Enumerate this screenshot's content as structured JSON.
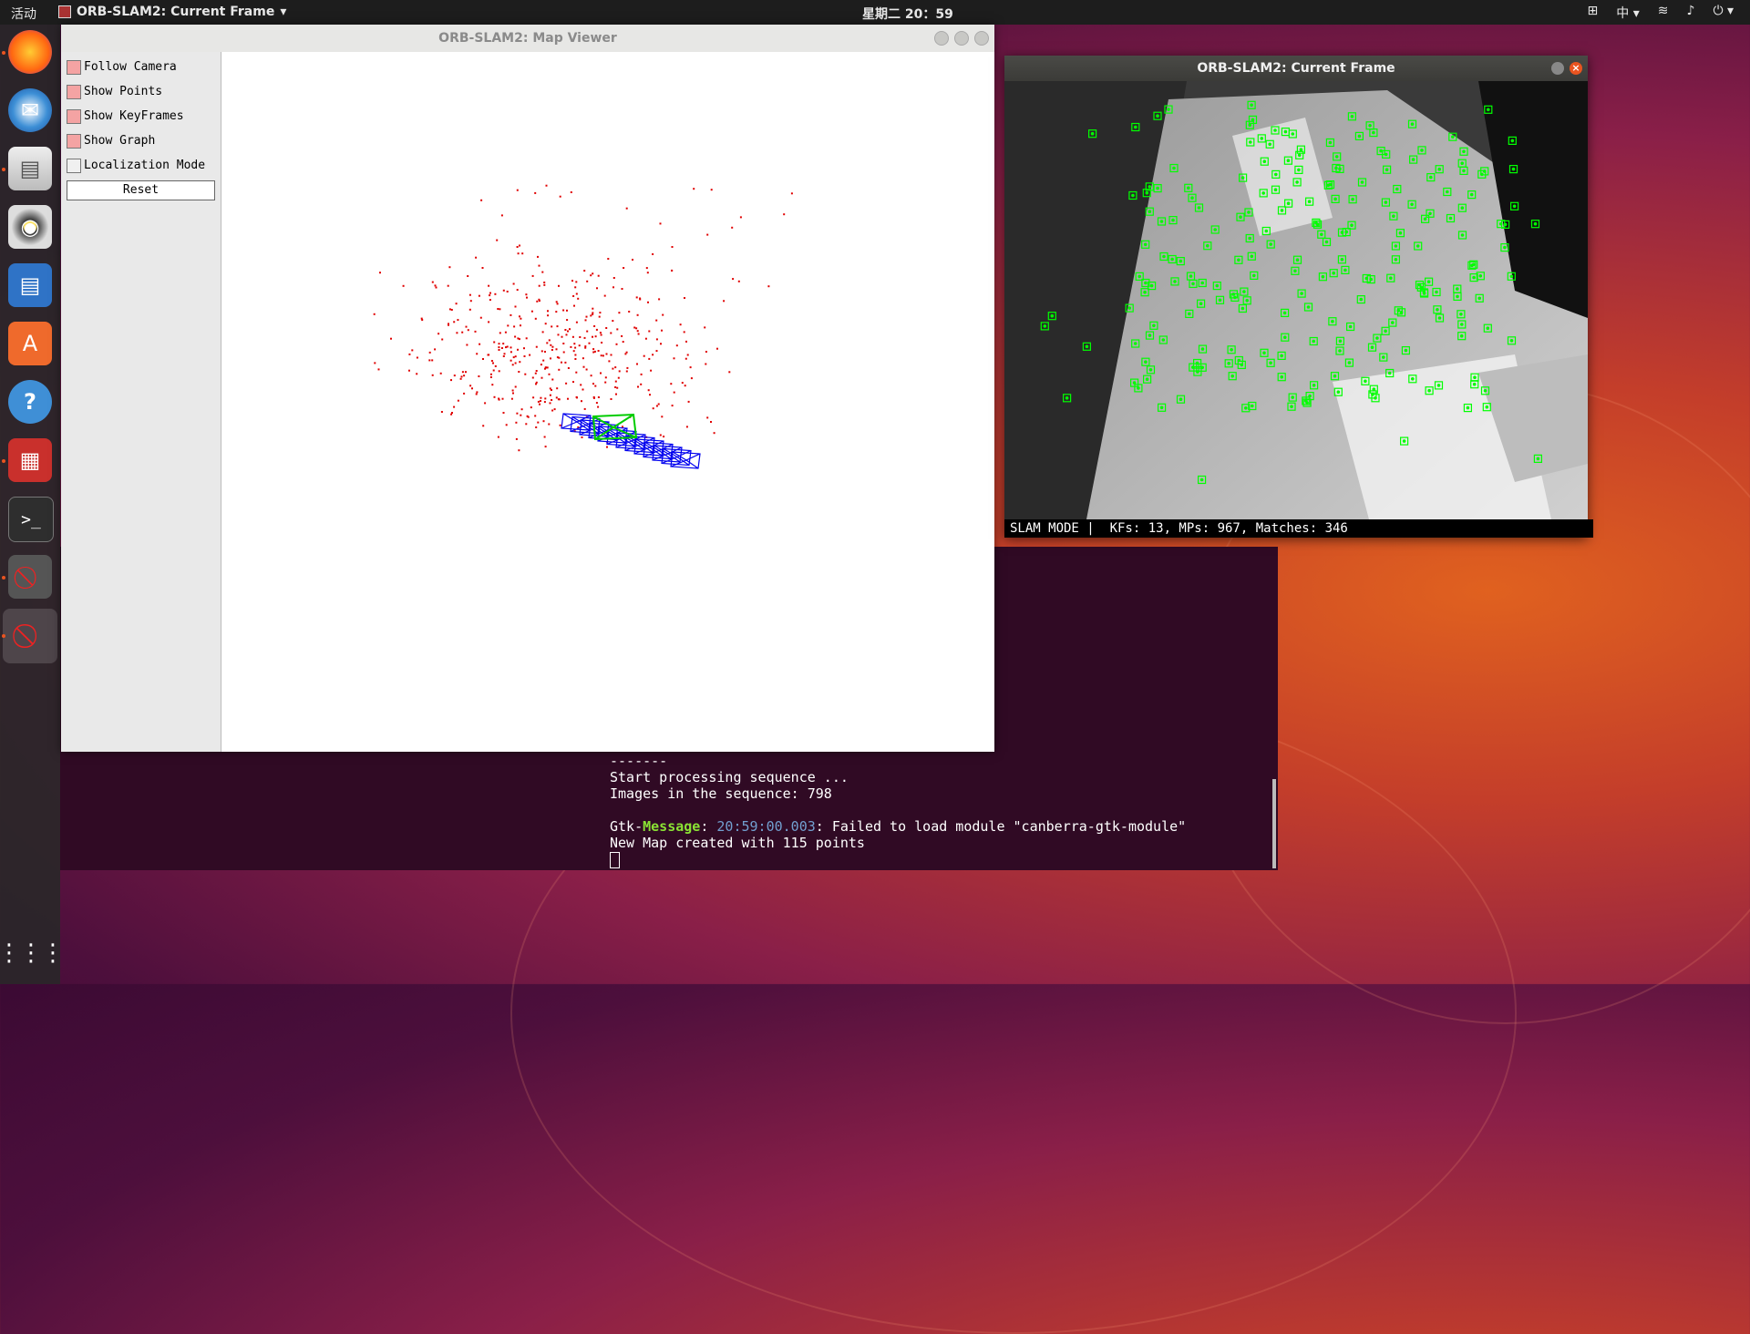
{
  "topbar": {
    "activities": "活动",
    "app_menu_label": "ORB-SLAM2: Current Frame",
    "clock": "星期二 20：59",
    "input_method": "中",
    "icons": [
      "network-icon",
      "input-method-icon",
      "wifi-icon",
      "volume-icon",
      "power-icon"
    ]
  },
  "dock": {
    "items": [
      "firefox-icon",
      "thunderbird-icon",
      "files-icon",
      "rhythmbox-icon",
      "writer-icon",
      "software-icon",
      "help-icon",
      "app-icon",
      "terminal-icon",
      "blocked-app-icon",
      "blocked-app-icon-active"
    ],
    "show_apps_icon": "grid-icon"
  },
  "terminal": {
    "lines": [
      "-------",
      "Start processing sequence ...",
      "Images in the sequence: 798",
      ""
    ],
    "gtk_prefix": "Gtk-",
    "gtk_key": "Message",
    "gtk_time": "20:59:00.003",
    "gtk_rest": ": Failed to load module \"canberra-gtk-module\"",
    "last_line": "New Map created with 115 points",
    "colors": {
      "bg": "#300a24",
      "green": "#8ae234",
      "blue": "#729fcf"
    }
  },
  "map_viewer": {
    "title": "ORB-SLAM2: Map Viewer",
    "options": [
      {
        "label": "Follow Camera",
        "checked": true
      },
      {
        "label": "Show Points",
        "checked": true
      },
      {
        "label": "Show KeyFrames",
        "checked": true
      },
      {
        "label": "Show Graph",
        "checked": true
      },
      {
        "label": "Localization Mode",
        "checked": false
      }
    ],
    "reset_label": "Reset",
    "colors": {
      "points": "#e00000",
      "keyframes": "#0000ee",
      "current_camera": "#00cc00"
    }
  },
  "current_frame": {
    "title": "ORB-SLAM2: Current Frame",
    "status": "SLAM MODE |  KFs: 13, MPs: 967, Matches: 346",
    "feature_color": "#00ff00"
  }
}
